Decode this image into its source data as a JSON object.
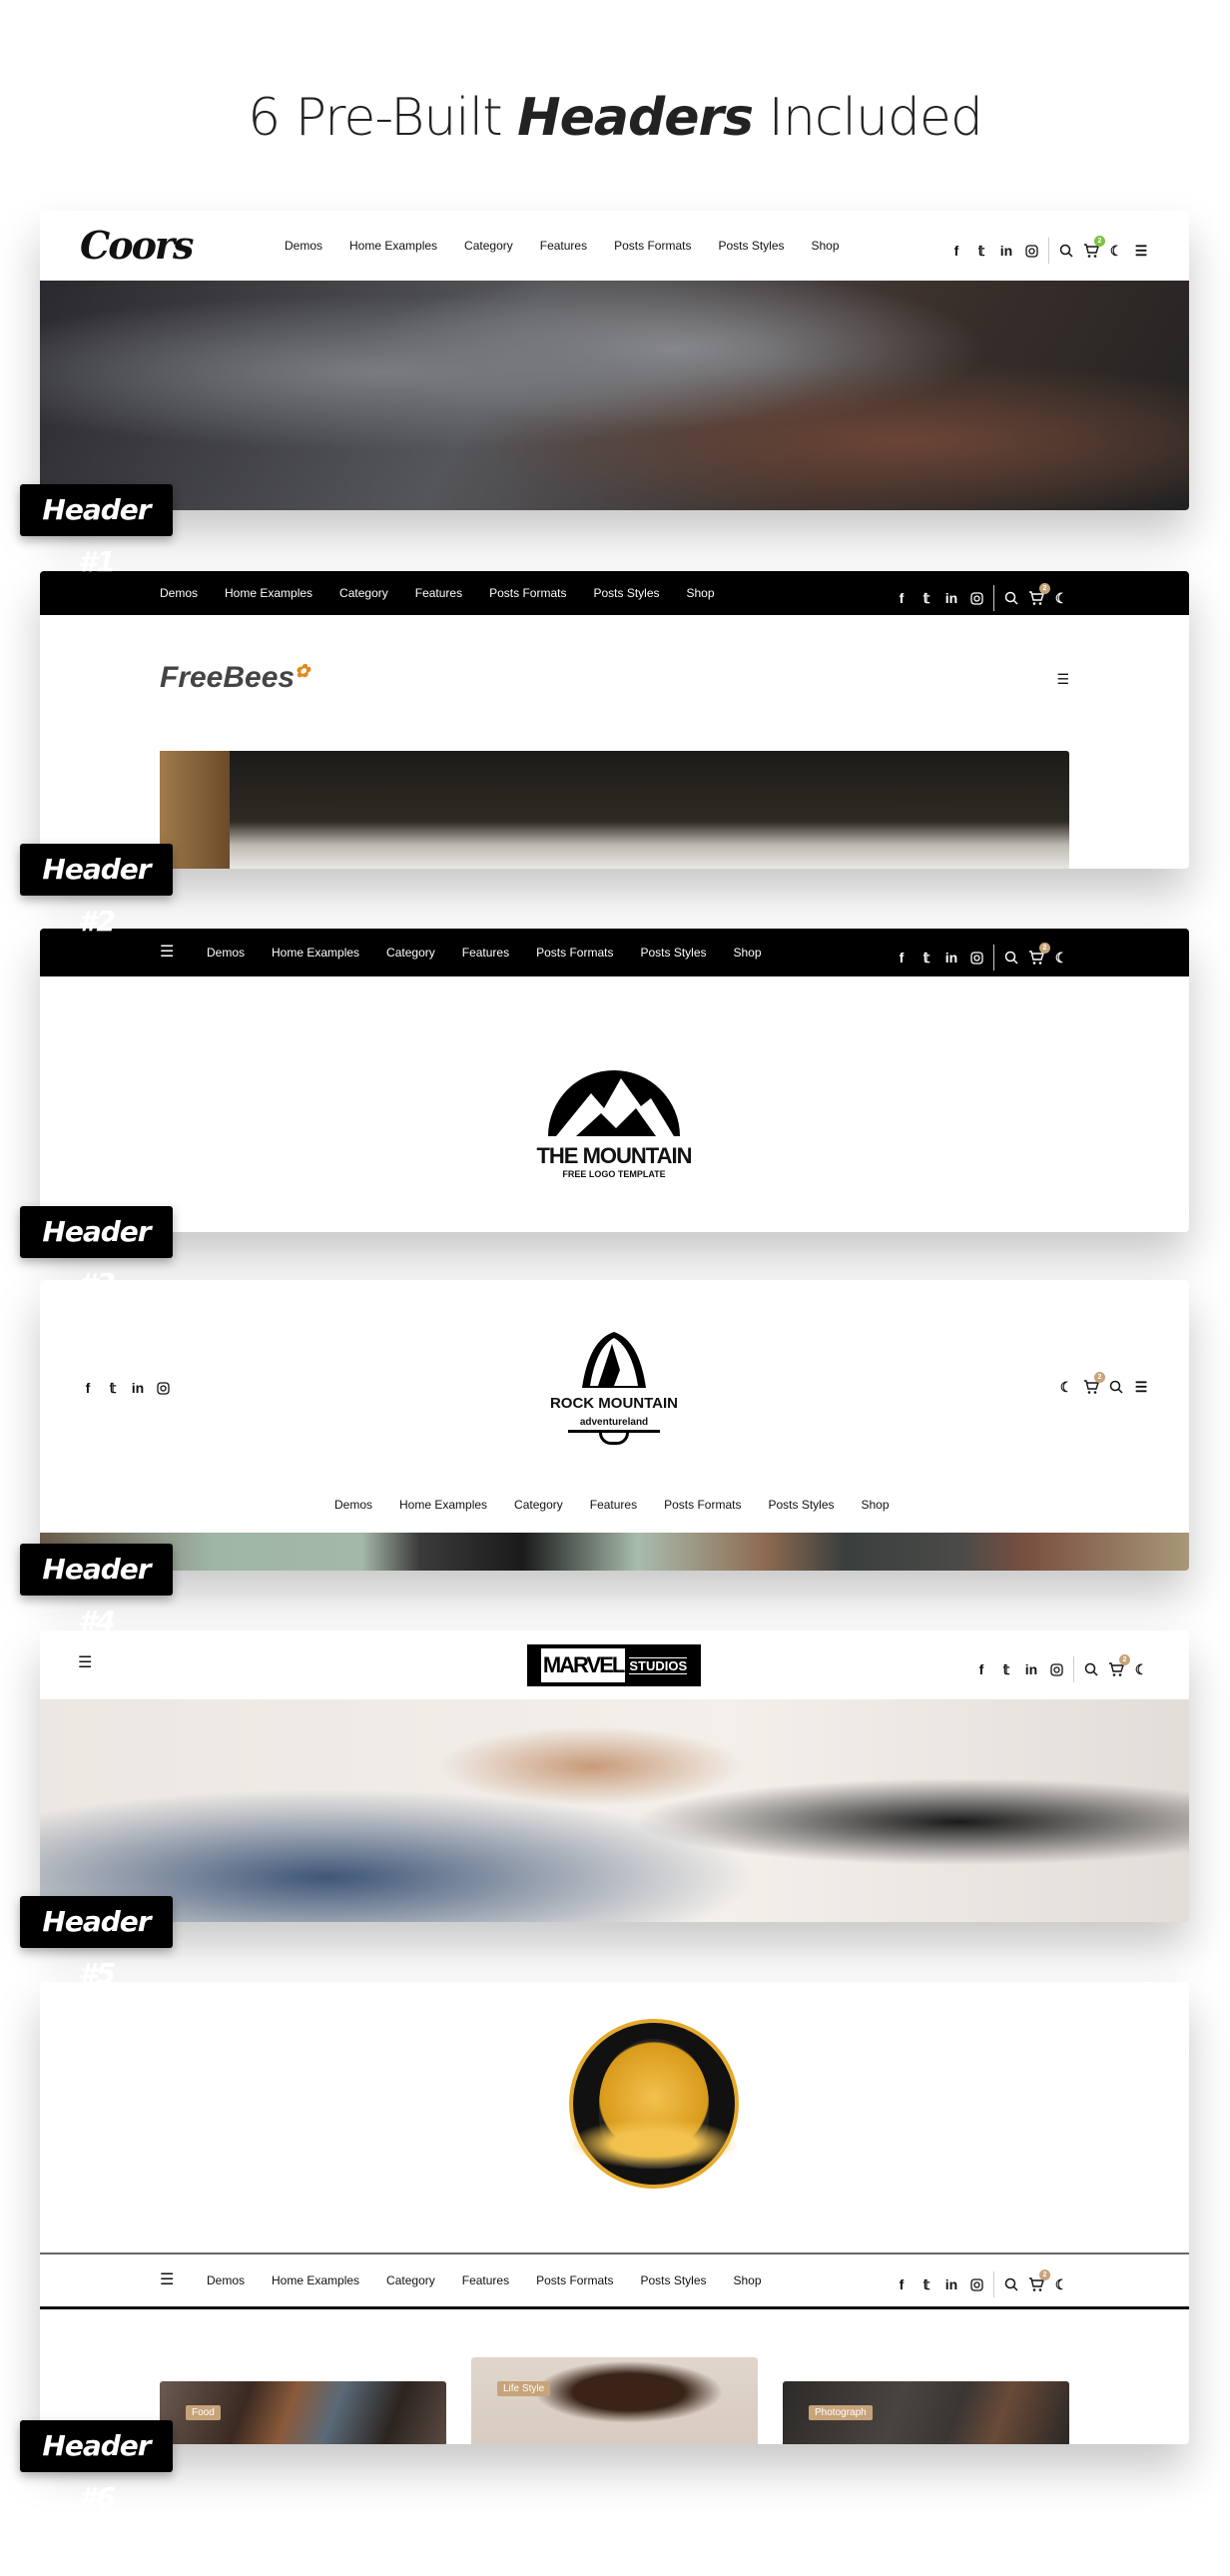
{
  "title": {
    "pre": "6 Pre-Built ",
    "bold": "Headers",
    "post": " Included"
  },
  "nav": [
    "Demos",
    "Home Examples",
    "Category",
    "Features",
    "Posts Formats",
    "Posts Styles",
    "Shop"
  ],
  "cart_count": "2",
  "colors": {
    "badge_green": "#7cc241",
    "badge_gold": "#c7a37a",
    "tag": "#c7a37a"
  },
  "icons": [
    "facebook-icon",
    "twitter-icon",
    "linkedin-icon",
    "instagram-icon",
    "search-icon",
    "cart-icon",
    "moon-icon",
    "menu-icon"
  ],
  "headers": [
    {
      "label": "Header #1",
      "logo": "Coors"
    },
    {
      "label": "Header #2",
      "logo": "FreeBees"
    },
    {
      "label": "Header #3",
      "logo": "THE MOUNTAIN",
      "logo_sub": "FREE LOGO TEMPLATE"
    },
    {
      "label": "Header #4",
      "logo": "ROCK MOUNTAIN",
      "logo_sub": "adventureland"
    },
    {
      "label": "Header #5",
      "logo": "MARVEL",
      "logo_sub": "STUDIOS"
    },
    {
      "label": "Header #6",
      "tags": [
        "Food",
        "Life Style",
        "Photograph"
      ]
    }
  ]
}
